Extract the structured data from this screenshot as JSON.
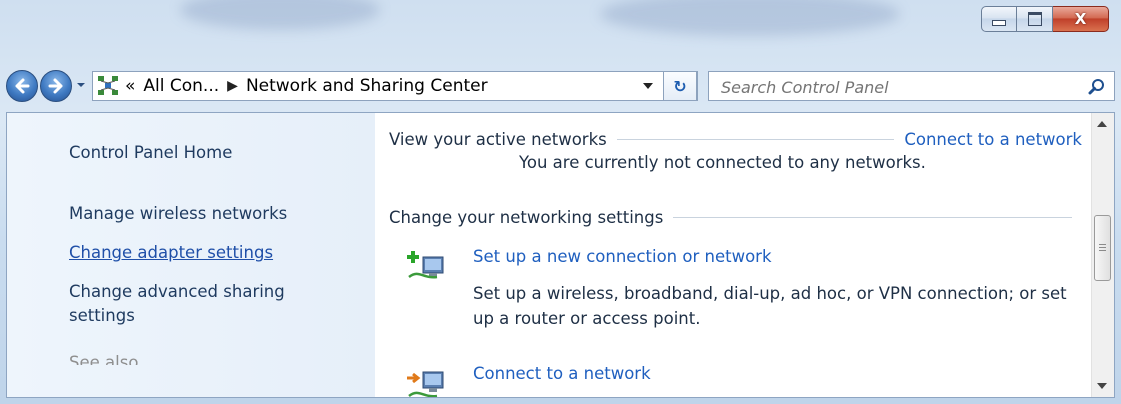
{
  "window": {
    "caption": {
      "minimize": "minimize",
      "maximize": "maximize",
      "close_glyph": "X"
    }
  },
  "nav": {
    "address": {
      "overflow": "«",
      "crumbs": [
        "All Con...",
        "Network and Sharing Center"
      ]
    },
    "refresh_glyph": "↻",
    "search": {
      "placeholder": "Search Control Panel"
    }
  },
  "sidebar": {
    "items": [
      {
        "label": "Control Panel Home"
      },
      {
        "label": "Manage wireless networks"
      },
      {
        "label": "Change adapter settings"
      },
      {
        "label": "Change advanced sharing settings"
      },
      {
        "label": "See also"
      }
    ]
  },
  "main": {
    "active": {
      "heading": "View your active networks",
      "link": "Connect to a network",
      "message": "You are currently not connected to any networks."
    },
    "change": {
      "heading": "Change your networking settings",
      "tasks": [
        {
          "title": "Set up a new connection or network",
          "description": "Set up a wireless, broadband, dial-up, ad hoc, or VPN connection; or set up a router or access point.",
          "icon": "new-connection-icon"
        },
        {
          "title": "Connect to a network",
          "icon": "connect-network-icon"
        }
      ]
    }
  },
  "colors": {
    "link": "#1f5fbf",
    "text": "#1e2f45",
    "sidebar_bg": "#eaf2fb"
  }
}
